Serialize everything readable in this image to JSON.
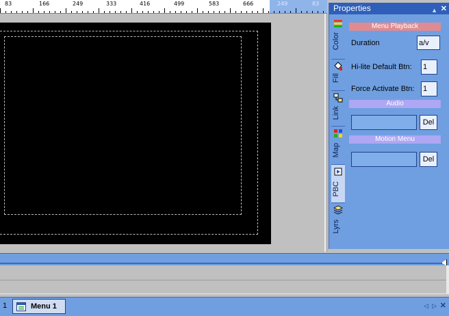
{
  "ruler": {
    "labels": [
      "83",
      "166",
      "249",
      "333",
      "416",
      "499",
      "583",
      "666",
      "249",
      "83"
    ]
  },
  "properties": {
    "title": "Properties",
    "pin_icon": "pin-icon",
    "close_icon": "close-icon",
    "tabs": [
      {
        "label": "Color",
        "icon": "color-icon"
      },
      {
        "label": "Fill",
        "icon": "fill-bucket-icon"
      },
      {
        "label": "Link",
        "icon": "link-icon"
      },
      {
        "label": "Map",
        "icon": "map-icon"
      },
      {
        "label": "PBC",
        "icon": "pbc-icon"
      },
      {
        "label": "Lyrs",
        "icon": "layers-icon"
      }
    ],
    "active_tab": "PBC",
    "menu_playback": {
      "header": "Menu Playback",
      "duration_label": "Duration",
      "duration_value": "a/v",
      "hilite_label": "Hi-lite Default Btn:",
      "hilite_value": "1",
      "force_label": "Force Activate Btn:",
      "force_value": "1"
    },
    "audio": {
      "header": "Audio",
      "value": "",
      "del_label": "Del"
    },
    "motion_menu": {
      "header": "Motion Menu",
      "value": "",
      "del_label": "Del"
    }
  },
  "tabbar": {
    "page_number": "1",
    "tab_label": "Menu 1",
    "tab_icon": "menu-icon",
    "prev_icon": "prev-arrow-icon",
    "next_icon": "next-arrow-icon",
    "close_icon": "close-icon"
  },
  "colors": {
    "panel_blue": "#6f9fe0",
    "title_blue": "#2f5fb8",
    "section_pink": "#e08b92",
    "section_lilac": "#aea7f4",
    "stage_black": "#000000"
  }
}
